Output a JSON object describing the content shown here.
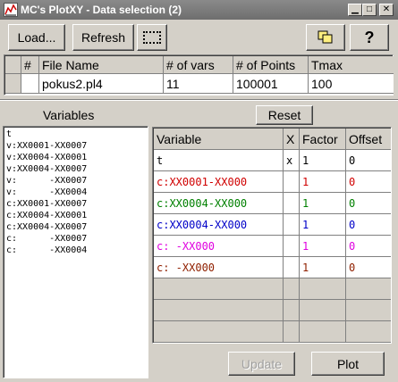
{
  "window": {
    "title": "MC's PlotXY - Data selection (2)"
  },
  "toolbar": {
    "load_label": "Load...",
    "refresh_label": "Refresh",
    "help_label": "?"
  },
  "files_table": {
    "headers": [
      "#",
      "File Name",
      "# of vars",
      "# of Points",
      "Tmax"
    ],
    "rows": [
      {
        "num": "",
        "file": "pokus2.pl4",
        "vars": "11",
        "points": "100001",
        "tmax": "100"
      }
    ]
  },
  "variables": {
    "label": "Variables",
    "items": [
      "t",
      "v:XX0001-XX0007",
      "v:XX0004-XX0001",
      "v:XX0004-XX0007",
      "v:      -XX0007",
      "v:      -XX0004",
      "c:XX0001-XX0007",
      "c:XX0004-XX0001",
      "c:XX0004-XX0007",
      "c:      -XX0007",
      "c:      -XX0004"
    ]
  },
  "reset_label": "Reset",
  "plot_table": {
    "headers": [
      "Variable",
      "X",
      "Factor",
      "Offset"
    ],
    "rows": [
      {
        "variable": "t",
        "x": "x",
        "factor": "1",
        "offset": "0",
        "color": "#000000"
      },
      {
        "variable": "c:XX0001-XX000",
        "x": "",
        "factor": "1",
        "offset": "0",
        "color": "#d00000"
      },
      {
        "variable": "c:XX0004-XX000",
        "x": "",
        "factor": "1",
        "offset": "0",
        "color": "#008000"
      },
      {
        "variable": "c:XX0004-XX000",
        "x": "",
        "factor": "1",
        "offset": "0",
        "color": "#0000c8"
      },
      {
        "variable": "c:      -XX000",
        "x": "",
        "factor": "1",
        "offset": "0",
        "color": "#e000e0"
      },
      {
        "variable": "c:      -XX000",
        "x": "",
        "factor": "1",
        "offset": "0",
        "color": "#902000"
      },
      {
        "variable": "",
        "x": "",
        "factor": "",
        "offset": "",
        "color": "#000000"
      },
      {
        "variable": "",
        "x": "",
        "factor": "",
        "offset": "",
        "color": "#000000"
      },
      {
        "variable": "",
        "x": "",
        "factor": "",
        "offset": "",
        "color": "#000000"
      }
    ]
  },
  "update_label": "Update",
  "plot_label": "Plot",
  "colors": {
    "face": "#d4d0c8",
    "title_bar": "#7a7a7a"
  }
}
